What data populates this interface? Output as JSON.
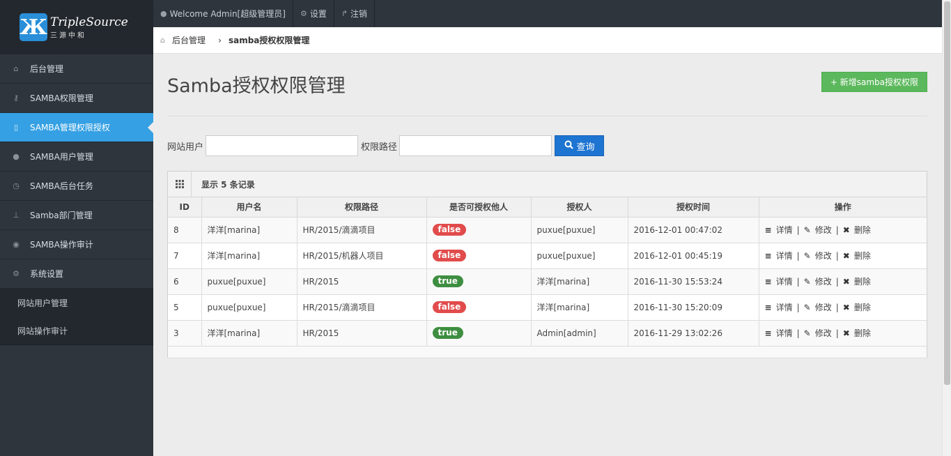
{
  "brand": {
    "mark": "Ж",
    "title": "TripleSource",
    "subtitle": "三源中和"
  },
  "sidebar": {
    "items": [
      {
        "label": "后台管理",
        "icon": "home-icon"
      },
      {
        "label": "SAMBA权限管理",
        "icon": "key-icon"
      },
      {
        "label": "SAMBA管理权限授权",
        "icon": "file-icon"
      },
      {
        "label": "SAMBA用户管理",
        "icon": "user-icon"
      },
      {
        "label": "SAMBA后台任务",
        "icon": "clock-icon"
      },
      {
        "label": "Samba部门管理",
        "icon": "sitemap-icon"
      },
      {
        "label": "SAMBA操作审计",
        "icon": "eye-icon"
      },
      {
        "label": "系统设置",
        "icon": "gears-icon"
      }
    ],
    "active_index": 2,
    "sub_items": [
      {
        "label": "网站用户管理"
      },
      {
        "label": "网站操作审计"
      }
    ]
  },
  "topbar": {
    "welcome": "Welcome Admin[超级管理员]",
    "settings": "设置",
    "logout": "注销"
  },
  "breadcrumb": {
    "home": "后台管理",
    "current": "samba授权权限管理"
  },
  "page": {
    "title": "Samba授权权限管理",
    "add_button": "+ 新增samba授权权限"
  },
  "search": {
    "user_label": "网站用户",
    "user_value": "",
    "path_label": "权限路径",
    "path_value": "",
    "button": "查询"
  },
  "table": {
    "summary": "显示 5 条记录",
    "columns": [
      "ID",
      "用户名",
      "权限路径",
      "是否可授权他人",
      "授权人",
      "授权时间",
      "操作"
    ],
    "rows": [
      {
        "id": "8",
        "user": "洋洋[marina]",
        "path": "HR/2015/滴滴项目",
        "grant": "false",
        "grantor": "puxue[puxue]",
        "time": "2016-12-01 00:47:02"
      },
      {
        "id": "7",
        "user": "洋洋[marina]",
        "path": "HR/2015/机器人项目",
        "grant": "false",
        "grantor": "puxue[puxue]",
        "time": "2016-12-01 00:45:19"
      },
      {
        "id": "6",
        "user": "puxue[puxue]",
        "path": "HR/2015",
        "grant": "true",
        "grantor": "洋洋[marina]",
        "time": "2016-11-30 15:53:24"
      },
      {
        "id": "5",
        "user": "puxue[puxue]",
        "path": "HR/2015/滴滴项目",
        "grant": "false",
        "grantor": "洋洋[marina]",
        "time": "2016-11-30 15:20:09"
      },
      {
        "id": "3",
        "user": "洋洋[marina]",
        "path": "HR/2015",
        "grant": "true",
        "grantor": "Admin[admin]",
        "time": "2016-11-29 13:02:26"
      }
    ],
    "actions": {
      "detail": "详情",
      "edit": "修改",
      "delete": "删除",
      "separator": "|"
    }
  },
  "colors": {
    "accent": "#35a0e3",
    "sidebar": "#2e353d",
    "success": "#5cb85c",
    "danger": "#e24b4b",
    "true_badge": "#3e8e41",
    "primary": "#1e74d1"
  }
}
